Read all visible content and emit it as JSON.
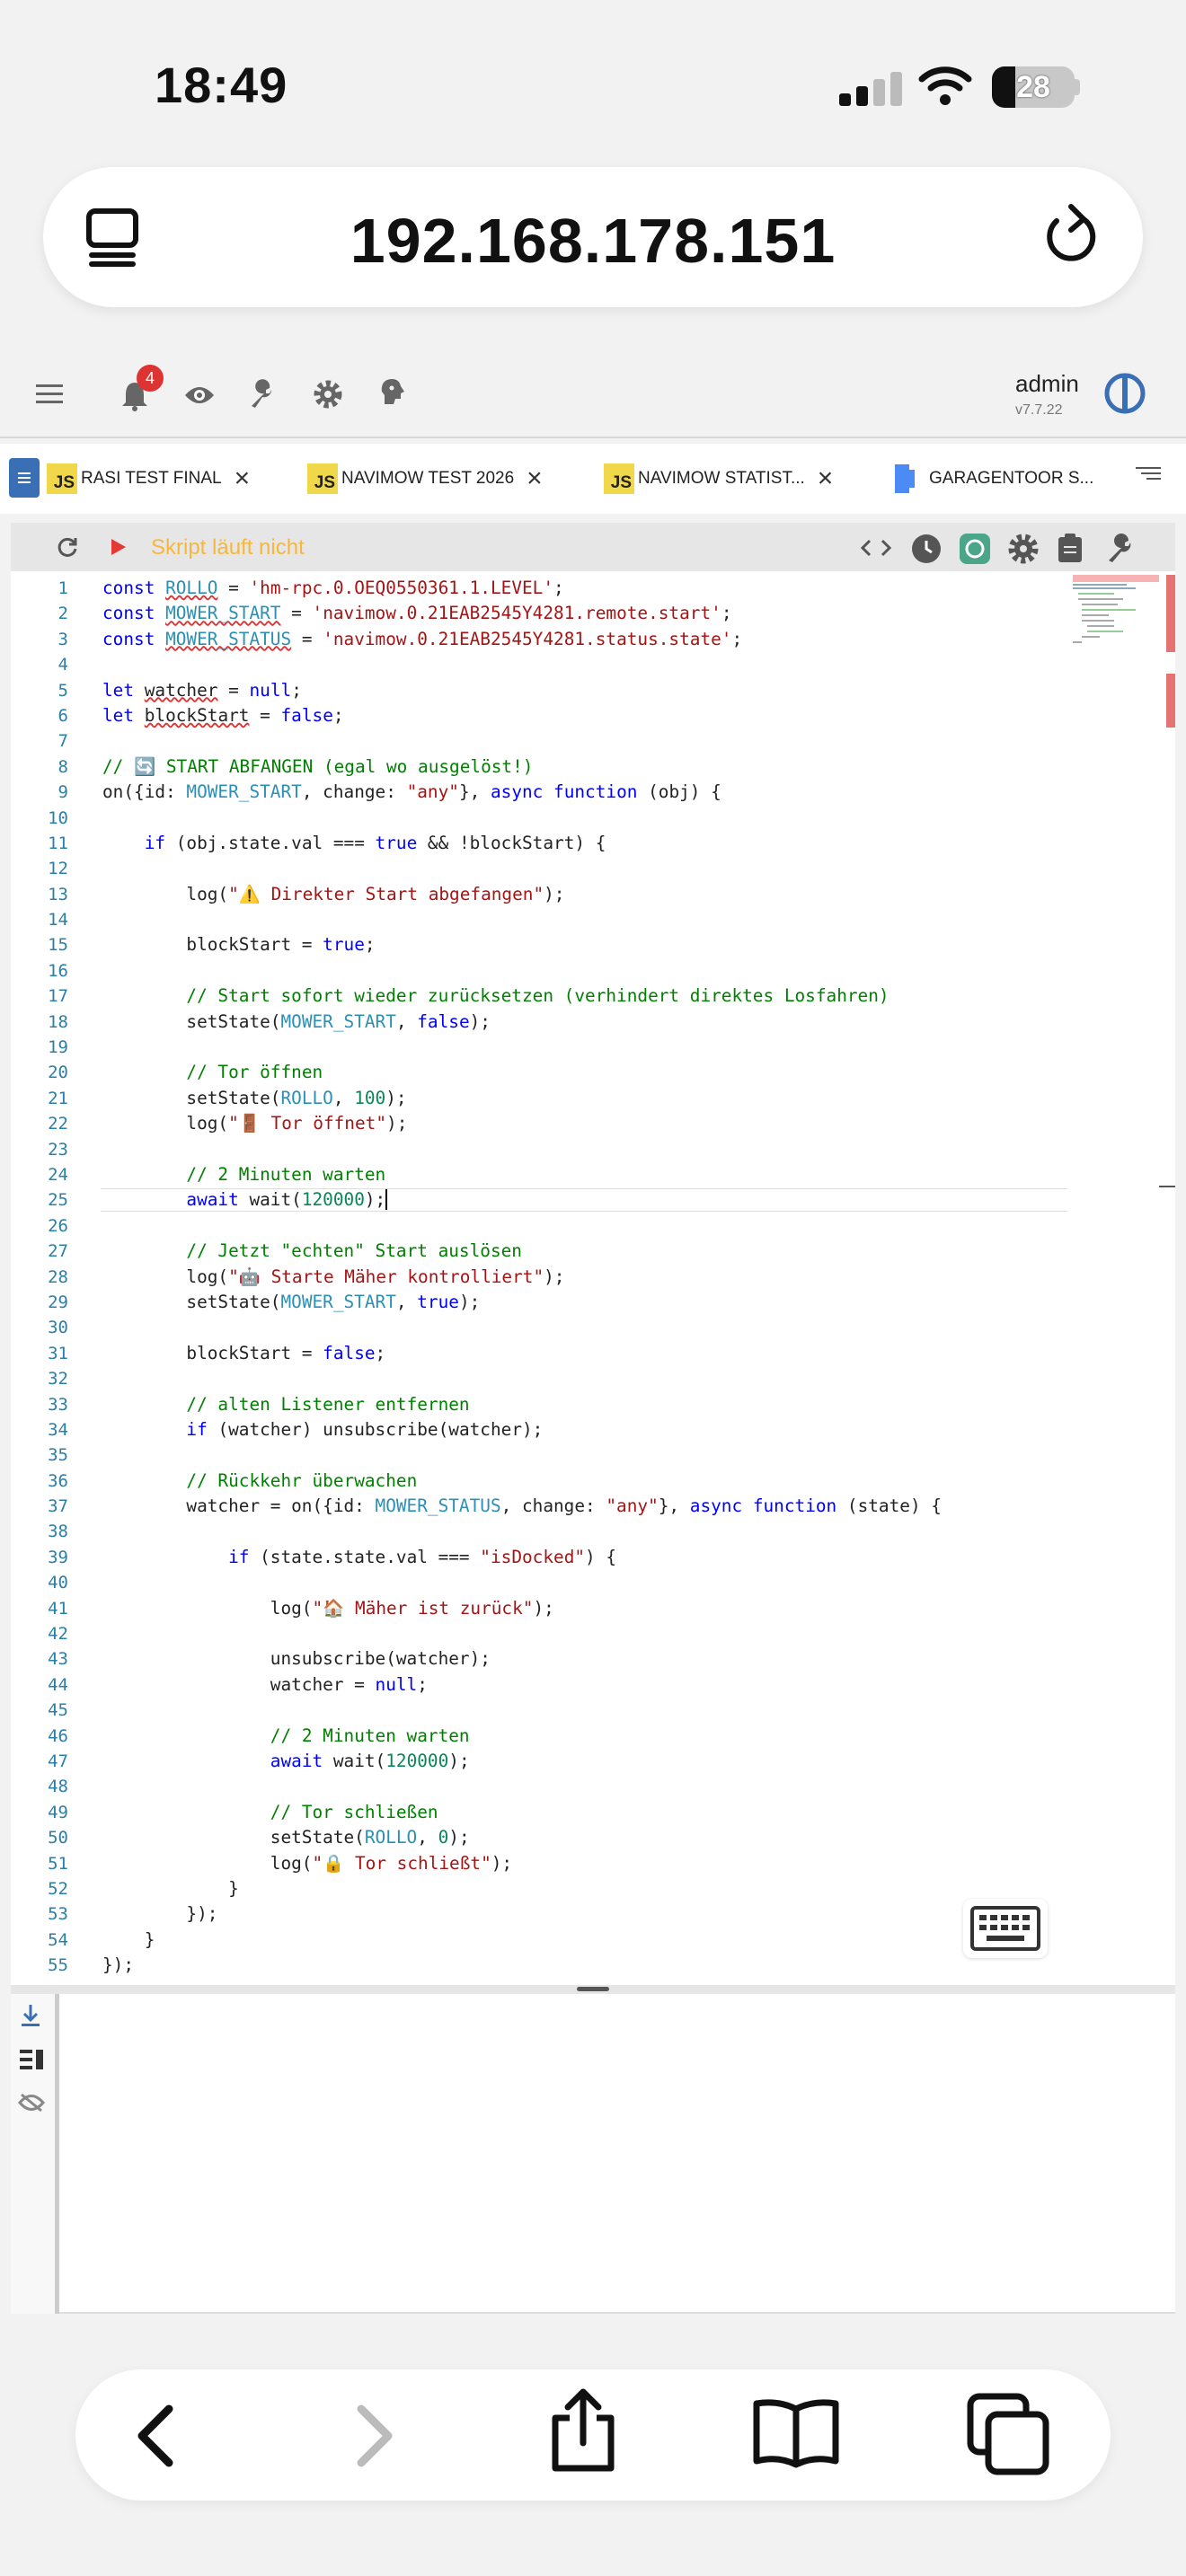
{
  "status_bar": {
    "time": "18:49",
    "battery": "28"
  },
  "browser": {
    "url": "192.168.178.151"
  },
  "toolbar": {
    "notification_count": "4",
    "user": "admin",
    "version": "v7.7.22"
  },
  "tabs": [
    {
      "label": "RASI TEST FINAL",
      "type": "JS"
    },
    {
      "label": "NAVIMOW TEST 2026",
      "type": "JS"
    },
    {
      "label": "NAVIMOW STATIST...",
      "type": "JS"
    },
    {
      "label": "GARAGENTOOR S...",
      "type": "blockly"
    }
  ],
  "editor": {
    "status_text": "Skript läuft nicht",
    "lines": [
      {
        "n": "1",
        "html": "<span class='k'>const</span> <span class='v u'>ROLLO</span> = <span class='s'>'hm-rpc.0.OEQ0550361.1.LEVEL'</span>;"
      },
      {
        "n": "2",
        "html": "<span class='k'>const</span> <span class='v u'>MOWER_START</span> = <span class='s'>'navimow.0.21EAB2545Y4281.remote.start'</span>;"
      },
      {
        "n": "3",
        "html": "<span class='k'>const</span> <span class='v u'>MOWER_STATUS</span> = <span class='s'>'navimow.0.21EAB2545Y4281.status.state'</span>;"
      },
      {
        "n": "4",
        "html": ""
      },
      {
        "n": "5",
        "html": "<span class='k'>let</span> <span class='u'>watcher</span> = <span class='k'>null</span>;"
      },
      {
        "n": "6",
        "html": "<span class='k'>let</span> <span class='u'>blockStart</span> = <span class='k'>false</span>;"
      },
      {
        "n": "7",
        "html": ""
      },
      {
        "n": "8",
        "html": "<span class='c'>// 🔄 START ABFANGEN (egal wo ausgelöst!)</span>"
      },
      {
        "n": "9",
        "html": "on({id: <span class='v'>MOWER_START</span>, change: <span class='s'>\"any\"</span>}, <span class='k'>async function</span> (obj) {"
      },
      {
        "n": "10",
        "html": ""
      },
      {
        "n": "11",
        "html": "    <span class='k'>if</span> (obj.state.val === <span class='k'>true</span> &amp;&amp; !blockStart) {"
      },
      {
        "n": "12",
        "html": ""
      },
      {
        "n": "13",
        "html": "        log(<span class='s'>\"⚠️ Direkter Start abgefangen\"</span>);"
      },
      {
        "n": "14",
        "html": ""
      },
      {
        "n": "15",
        "html": "        blockStart = <span class='k'>true</span>;"
      },
      {
        "n": "16",
        "html": ""
      },
      {
        "n": "17",
        "html": "        <span class='c'>// Start sofort wieder zurücksetzen (verhindert direktes Losfahren)</span>"
      },
      {
        "n": "18",
        "html": "        setState(<span class='v'>MOWER_START</span>, <span class='k'>false</span>);"
      },
      {
        "n": "19",
        "html": ""
      },
      {
        "n": "20",
        "html": "        <span class='c'>// Tor öffnen</span>"
      },
      {
        "n": "21",
        "html": "        setState(<span class='v'>ROLLO</span>, <span class='n'>100</span>);"
      },
      {
        "n": "22",
        "html": "        log(<span class='s'>\"🚪 Tor öffnet\"</span>);"
      },
      {
        "n": "23",
        "html": ""
      },
      {
        "n": "24",
        "html": "        <span class='c'>// 2 Minuten warten</span>"
      },
      {
        "n": "25",
        "html": "        <span class='k'>await</span> wait(<span class='n'>120000</span>);<span class='cur'></span>"
      },
      {
        "n": "26",
        "html": ""
      },
      {
        "n": "27",
        "html": "        <span class='c'>// Jetzt \"echten\" Start auslösen</span>"
      },
      {
        "n": "28",
        "html": "        log(<span class='s'>\"🤖 Starte Mäher kontrolliert\"</span>);"
      },
      {
        "n": "29",
        "html": "        setState(<span class='v'>MOWER_START</span>, <span class='k'>true</span>);"
      },
      {
        "n": "30",
        "html": ""
      },
      {
        "n": "31",
        "html": "        blockStart = <span class='k'>false</span>;"
      },
      {
        "n": "32",
        "html": ""
      },
      {
        "n": "33",
        "html": "        <span class='c'>// alten Listener entfernen</span>"
      },
      {
        "n": "34",
        "html": "        <span class='k'>if</span> (watcher) unsubscribe(watcher);"
      },
      {
        "n": "35",
        "html": ""
      },
      {
        "n": "36",
        "html": "        <span class='c'>// Rückkehr überwachen</span>"
      },
      {
        "n": "37",
        "html": "        watcher = on({id: <span class='v'>MOWER_STATUS</span>, change: <span class='s'>\"any\"</span>}, <span class='k'>async function</span> (state) {"
      },
      {
        "n": "38",
        "html": ""
      },
      {
        "n": "39",
        "html": "            <span class='k'>if</span> (state.state.val === <span class='s'>\"isDocked\"</span>) {"
      },
      {
        "n": "40",
        "html": ""
      },
      {
        "n": "41",
        "html": "                log(<span class='s'>\"🏠 Mäher ist zurück\"</span>);"
      },
      {
        "n": "42",
        "html": ""
      },
      {
        "n": "43",
        "html": "                unsubscribe(watcher);"
      },
      {
        "n": "44",
        "html": "                watcher = <span class='k'>null</span>;"
      },
      {
        "n": "45",
        "html": ""
      },
      {
        "n": "46",
        "html": "                <span class='c'>// 2 Minuten warten</span>"
      },
      {
        "n": "47",
        "html": "                <span class='k'>await</span> wait(<span class='n'>120000</span>);"
      },
      {
        "n": "48",
        "html": ""
      },
      {
        "n": "49",
        "html": "                <span class='c'>// Tor schließen</span>"
      },
      {
        "n": "50",
        "html": "                setState(<span class='v'>ROLLO</span>, <span class='n'>0</span>);"
      },
      {
        "n": "51",
        "html": "                log(<span class='s'>\"🔒 Tor schließt\"</span>);"
      },
      {
        "n": "52",
        "html": "            }"
      },
      {
        "n": "53",
        "html": "        });"
      },
      {
        "n": "54",
        "html": "    }"
      },
      {
        "n": "55",
        "html": "});"
      }
    ]
  },
  "icons": [
    "menu-icon",
    "bell-icon",
    "eye-icon",
    "wrench-icon",
    "gear-icon",
    "ghost-icon",
    "iobroker-logo-icon",
    "reload-icon",
    "play-icon",
    "code-icon",
    "clock-icon",
    "chatgpt-icon",
    "settings-icon",
    "clipboard-icon",
    "tool-icon",
    "keyboard-icon",
    "back-icon",
    "forward-icon",
    "share-icon",
    "bookmarks-icon",
    "tabs-icon"
  ]
}
